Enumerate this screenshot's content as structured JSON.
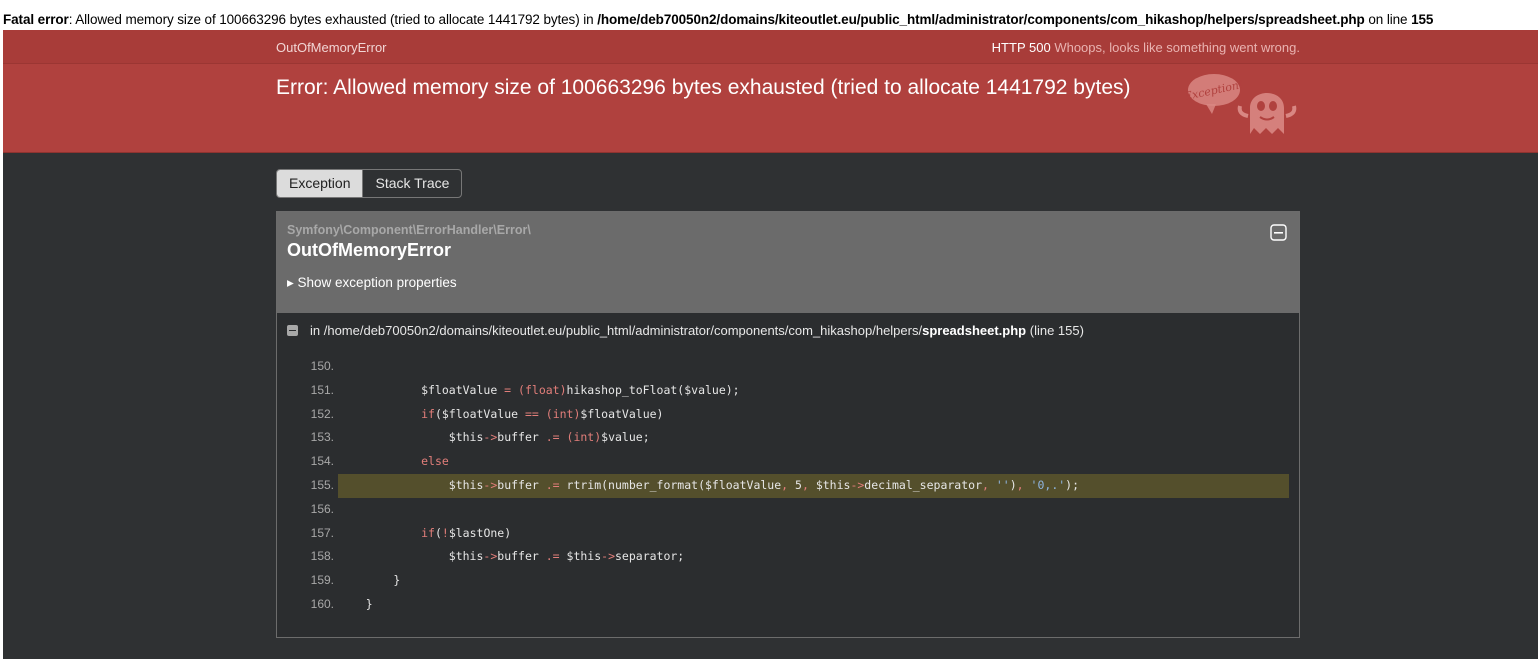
{
  "fatal": {
    "prefix": "Fatal error",
    "message": ": Allowed memory size of 100663296 bytes exhausted (tried to allocate 1441792 bytes) in ",
    "path": "/home/deb70050n2/domains/kiteoutlet.eu/public_html/administrator/components/com_hikashop/helpers/spreadsheet.php",
    "on_line": " on line ",
    "line": "155"
  },
  "header": {
    "exception_short": "OutOfMemoryError",
    "http_code": "HTTP 500",
    "http_message": "Whoops, looks like something went wrong.",
    "title": "Error: Allowed memory size of 100663296 bytes exhausted (tried to allocate 1441792 bytes)",
    "ghost_text": "Exception!"
  },
  "tabs": [
    {
      "label": "Exception",
      "active": true
    },
    {
      "label": "Stack Trace",
      "active": false
    }
  ],
  "exception": {
    "namespace": "Symfony\\Component\\ErrorHandler\\Error\\",
    "class": "OutOfMemoryError",
    "show_properties": "▸ Show exception properties",
    "file_prefix": "in /home/deb70050n2/domains/kiteoutlet.eu/public_html/administrator/components/com_hikashop/helpers/",
    "file_name": "spreadsheet.php",
    "file_suffix": " (line 155)"
  },
  "code": [
    {
      "n": "150.",
      "code": ""
    },
    {
      "n": "151.",
      "code": "            $floatValue = (float)hikashop_toFloat($value);"
    },
    {
      "n": "152.",
      "code": "            if($floatValue == (int)$floatValue)"
    },
    {
      "n": "153.",
      "code": "                $this->buffer .= (int)$value;"
    },
    {
      "n": "154.",
      "code": "            else"
    },
    {
      "n": "155.",
      "code": "                $this->buffer .= rtrim(number_format($floatValue, 5, $this->decimal_separator, ''), '0,.');",
      "highlight": true
    },
    {
      "n": "156.",
      "code": ""
    },
    {
      "n": "157.",
      "code": "            if(!$lastOne)"
    },
    {
      "n": "158.",
      "code": "                $this->buffer .= $this->separator;"
    },
    {
      "n": "159.",
      "code": "        }"
    },
    {
      "n": "160.",
      "code": "    }"
    }
  ],
  "colors": {
    "header_bg": "#b0413e",
    "page_bg": "#2f3133",
    "highlight_bg": "#544f2c"
  }
}
